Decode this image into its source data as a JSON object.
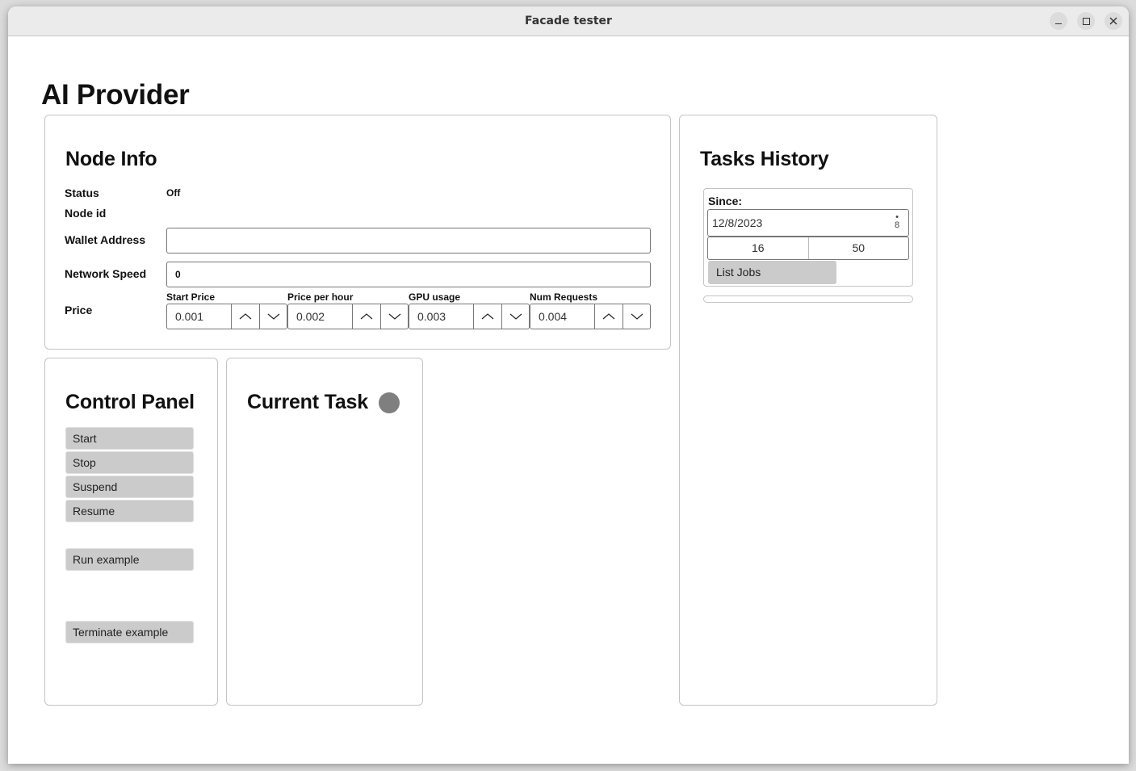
{
  "window": {
    "title": "Facade tester",
    "controls": {
      "minimize": "minimize-icon",
      "maximize": "maximize-icon",
      "close": "close-icon"
    }
  },
  "page": {
    "title": "AI Provider"
  },
  "node_info": {
    "heading": "Node Info",
    "status_label": "Status",
    "status_value": "Off",
    "node_id_label": "Node id",
    "node_id_value": "",
    "wallet_label": "Wallet Address",
    "wallet_value": "",
    "network_speed_label": "Network Speed",
    "network_speed_value": "0",
    "price_label": "Price",
    "prices": [
      {
        "label": "Start Price",
        "value": "0.001"
      },
      {
        "label": "Price per hour",
        "value": "0.002"
      },
      {
        "label": "GPU usage",
        "value": "0.003"
      },
      {
        "label": "Num Requests",
        "value": "0.004"
      }
    ],
    "spinner_icons": {
      "up": "chevron-up-icon",
      "down": "chevron-down-icon"
    }
  },
  "control_panel": {
    "heading": "Control Panel",
    "buttons": [
      "Start",
      "Stop",
      "Suspend",
      "Resume",
      "Run example",
      "Terminate example"
    ]
  },
  "current_task": {
    "heading": "Current Task",
    "status_color": "#7f7f7f"
  },
  "tasks_history": {
    "heading": "Tasks History",
    "since_label": "Since:",
    "date_value": "12/8/2023",
    "date_spinner_text": "8",
    "hour_value": "16",
    "minute_value": "50",
    "list_button": "List Jobs",
    "progress": 0
  }
}
